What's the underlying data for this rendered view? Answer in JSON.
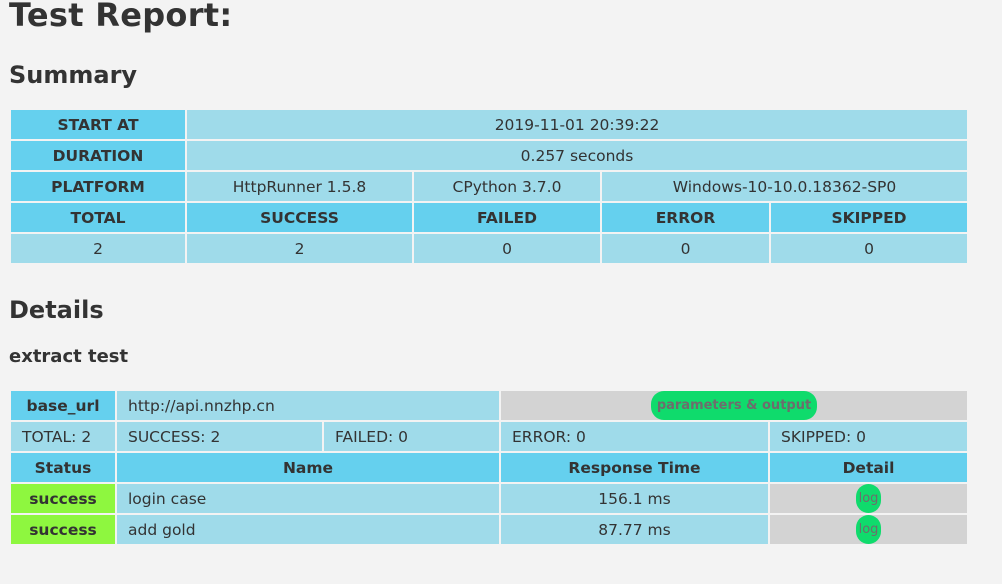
{
  "page": {
    "title": "Test Report:",
    "summary_heading": "Summary",
    "details_heading": "Details"
  },
  "summary": {
    "start_label": "START AT",
    "start_value": "2019-11-01 20:39:22",
    "duration_label": "DURATION",
    "duration_value": "0.257 seconds",
    "platform_label": "PLATFORM",
    "platform_runner": "HttpRunner 1.5.8",
    "platform_python": "CPython 3.7.0",
    "platform_os": "Windows-10-10.0.18362-SP0",
    "headers": [
      "TOTAL",
      "SUCCESS",
      "FAILED",
      "ERROR",
      "SKIPPED"
    ],
    "values": [
      "2",
      "2",
      "0",
      "0",
      "0"
    ]
  },
  "suite": {
    "name": "extract test",
    "base_url_label": "base_url",
    "base_url_value": "http://api.nnzhp.cn",
    "params_button": "parameters & output",
    "total": "TOTAL: 2",
    "success": "SUCCESS: 2",
    "failed": "FAILED: 0",
    "error": "ERROR: 0",
    "skipped": "SKIPPED: 0",
    "columns": [
      "Status",
      "Name",
      "Response Time",
      "Detail"
    ],
    "rows": [
      {
        "status": "success",
        "name": "login case",
        "time": "156.1 ms",
        "detail": "log"
      },
      {
        "status": "success",
        "name": "add gold",
        "time": "87.77 ms",
        "detail": "log"
      }
    ]
  },
  "colors": {
    "background": "#f3f3f3",
    "header_blue": "#65d0ee",
    "cell_blue": "#9fdbea",
    "gray": "#d3d3d3",
    "success_green": "#8ef73f",
    "pill_green": "#0fdb6c"
  }
}
